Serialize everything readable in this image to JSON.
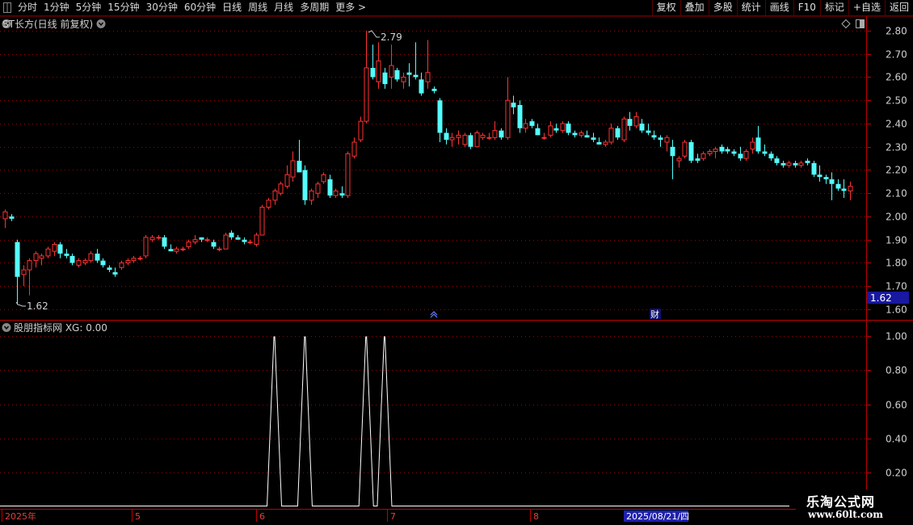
{
  "toolbar": {
    "periods": [
      "分时",
      "1分钟",
      "5分钟",
      "15分钟",
      "30分钟",
      "60分钟",
      "日线",
      "周线",
      "月线",
      "多周期",
      "更多 >"
    ],
    "active_period": "日线",
    "right_buttons": [
      "复权",
      "叠加",
      "多股",
      "统计",
      "画线",
      "F10",
      "标记",
      "+自选",
      "返回"
    ]
  },
  "main_chart": {
    "title": "ST长方(日线 前复权)",
    "high_label": "2.79",
    "low_label": "1.62",
    "current_price_tag": "1.62",
    "event_marker": "财",
    "price_axis": [
      "2.80",
      "2.70",
      "2.60",
      "2.50",
      "2.40",
      "2.30",
      "2.20",
      "2.10",
      "2.00",
      "1.90",
      "1.80",
      "1.70",
      "1.60"
    ]
  },
  "indicator": {
    "title": "股朋指标网 XG: 0.00",
    "axis": [
      "1.00",
      "0.80",
      "0.60",
      "0.40",
      "0.20"
    ]
  },
  "date_axis": {
    "labels": [
      "2025年",
      "5",
      "6",
      "7",
      "8"
    ],
    "cursor_date": "2025/08/21/四"
  },
  "watermark": {
    "line1": "乐淘公式网",
    "line2": "www.60lt.com"
  },
  "colors": {
    "up": "#ff3232",
    "down": "#54fcfc",
    "grid": "#a00000",
    "signal": "#ffffff"
  },
  "chart_data": {
    "type": "candlestick",
    "ylim": [
      1.6,
      2.82
    ],
    "ohlc": [
      [
        1.99,
        2.03,
        1.95,
        2.02
      ],
      [
        2.0,
        2.01,
        1.98,
        1.99
      ],
      [
        1.89,
        1.9,
        1.62,
        1.74
      ],
      [
        1.75,
        1.79,
        1.7,
        1.77
      ],
      [
        1.77,
        1.82,
        1.66,
        1.81
      ],
      [
        1.81,
        1.85,
        1.78,
        1.84
      ],
      [
        1.82,
        1.84,
        1.79,
        1.83
      ],
      [
        1.83,
        1.87,
        1.82,
        1.86
      ],
      [
        1.85,
        1.89,
        1.83,
        1.88
      ],
      [
        1.88,
        1.89,
        1.82,
        1.84
      ],
      [
        1.84,
        1.86,
        1.82,
        1.83
      ],
      [
        1.83,
        1.84,
        1.79,
        1.8
      ],
      [
        1.79,
        1.82,
        1.78,
        1.81
      ],
      [
        1.8,
        1.82,
        1.79,
        1.81
      ],
      [
        1.81,
        1.85,
        1.8,
        1.84
      ],
      [
        1.84,
        1.86,
        1.8,
        1.81
      ],
      [
        1.81,
        1.82,
        1.78,
        1.79
      ],
      [
        1.78,
        1.79,
        1.76,
        1.77
      ],
      [
        1.76,
        1.78,
        1.74,
        1.75
      ],
      [
        1.78,
        1.81,
        1.77,
        1.8
      ],
      [
        1.8,
        1.82,
        1.79,
        1.81
      ],
      [
        1.81,
        1.83,
        1.8,
        1.82
      ],
      [
        1.82,
        1.83,
        1.81,
        1.82
      ],
      [
        1.83,
        1.92,
        1.82,
        1.91
      ],
      [
        1.9,
        1.92,
        1.89,
        1.91
      ],
      [
        1.91,
        1.92,
        1.9,
        1.91
      ],
      [
        1.91,
        1.92,
        1.86,
        1.87
      ],
      [
        1.86,
        1.88,
        1.85,
        1.85
      ],
      [
        1.85,
        1.87,
        1.84,
        1.86
      ],
      [
        1.86,
        1.87,
        1.85,
        1.86
      ],
      [
        1.87,
        1.9,
        1.86,
        1.89
      ],
      [
        1.89,
        1.92,
        1.88,
        1.9
      ],
      [
        1.91,
        1.91,
        1.89,
        1.9
      ],
      [
        1.9,
        1.91,
        1.89,
        1.9
      ],
      [
        1.89,
        1.9,
        1.86,
        1.87
      ],
      [
        1.86,
        1.87,
        1.85,
        1.86
      ],
      [
        1.86,
        1.93,
        1.86,
        1.92
      ],
      [
        1.93,
        1.94,
        1.9,
        1.91
      ],
      [
        1.91,
        1.92,
        1.9,
        1.9
      ],
      [
        1.9,
        1.91,
        1.88,
        1.89
      ],
      [
        1.89,
        1.9,
        1.88,
        1.89
      ],
      [
        1.88,
        1.93,
        1.87,
        1.92
      ],
      [
        1.92,
        2.05,
        1.92,
        2.04
      ],
      [
        2.04,
        2.08,
        2.03,
        2.07
      ],
      [
        2.07,
        2.12,
        2.05,
        2.11
      ],
      [
        2.1,
        2.15,
        2.09,
        2.14
      ],
      [
        2.13,
        2.22,
        2.12,
        2.18
      ],
      [
        2.17,
        2.28,
        2.15,
        2.24
      ],
      [
        2.24,
        2.33,
        2.2,
        2.19
      ],
      [
        2.2,
        2.22,
        2.05,
        2.07
      ],
      [
        2.07,
        2.12,
        2.05,
        2.11
      ],
      [
        2.1,
        2.15,
        2.08,
        2.14
      ],
      [
        2.15,
        2.19,
        2.14,
        2.18
      ],
      [
        2.16,
        2.18,
        2.08,
        2.09
      ],
      [
        2.09,
        2.12,
        2.08,
        2.11
      ],
      [
        2.1,
        2.13,
        2.08,
        2.09
      ],
      [
        2.09,
        2.28,
        2.08,
        2.27
      ],
      [
        2.26,
        2.34,
        2.25,
        2.32
      ],
      [
        2.33,
        2.43,
        2.32,
        2.41
      ],
      [
        2.41,
        2.8,
        2.4,
        2.64
      ],
      [
        2.64,
        2.74,
        2.59,
        2.6
      ],
      [
        2.58,
        2.75,
        2.55,
        2.67
      ],
      [
        2.62,
        2.64,
        2.55,
        2.57
      ],
      [
        2.6,
        2.74,
        2.55,
        2.65
      ],
      [
        2.63,
        2.64,
        2.58,
        2.59
      ],
      [
        2.58,
        2.62,
        2.55,
        2.6
      ],
      [
        2.62,
        2.66,
        2.56,
        2.61
      ],
      [
        2.61,
        2.75,
        2.59,
        2.6
      ],
      [
        2.59,
        2.62,
        2.52,
        2.53
      ],
      [
        2.58,
        2.76,
        2.55,
        2.62
      ],
      [
        2.55,
        2.56,
        2.53,
        2.54
      ],
      [
        2.5,
        2.51,
        2.32,
        2.36
      ],
      [
        2.36,
        2.38,
        2.31,
        2.33
      ],
      [
        2.33,
        2.36,
        2.3,
        2.34
      ],
      [
        2.34,
        2.37,
        2.31,
        2.35
      ],
      [
        2.31,
        2.36,
        2.3,
        2.35
      ],
      [
        2.35,
        2.36,
        2.29,
        2.3
      ],
      [
        2.3,
        2.37,
        2.3,
        2.36
      ],
      [
        2.34,
        2.36,
        2.33,
        2.35
      ],
      [
        2.34,
        2.36,
        2.33,
        2.34
      ],
      [
        2.34,
        2.41,
        2.33,
        2.37
      ],
      [
        2.37,
        2.38,
        2.33,
        2.34
      ],
      [
        2.34,
        2.6,
        2.33,
        2.5
      ],
      [
        2.49,
        2.52,
        2.44,
        2.47
      ],
      [
        2.48,
        2.5,
        2.36,
        2.38
      ],
      [
        2.38,
        2.42,
        2.36,
        2.4
      ],
      [
        2.41,
        2.42,
        2.38,
        2.39
      ],
      [
        2.38,
        2.4,
        2.35,
        2.35
      ],
      [
        2.34,
        2.36,
        2.33,
        2.34
      ],
      [
        2.35,
        2.41,
        2.34,
        2.39
      ],
      [
        2.38,
        2.4,
        2.36,
        2.37
      ],
      [
        2.37,
        2.41,
        2.36,
        2.4
      ],
      [
        2.4,
        2.41,
        2.35,
        2.36
      ],
      [
        2.36,
        2.37,
        2.34,
        2.35
      ],
      [
        2.35,
        2.37,
        2.34,
        2.36
      ],
      [
        2.35,
        2.37,
        2.34,
        2.34
      ],
      [
        2.34,
        2.36,
        2.32,
        2.33
      ],
      [
        2.32,
        2.34,
        2.31,
        2.31
      ],
      [
        2.31,
        2.33,
        2.3,
        2.32
      ],
      [
        2.32,
        2.4,
        2.31,
        2.38
      ],
      [
        2.38,
        2.39,
        2.33,
        2.34
      ],
      [
        2.33,
        2.43,
        2.32,
        2.42
      ],
      [
        2.42,
        2.45,
        2.37,
        2.39
      ],
      [
        2.39,
        2.45,
        2.38,
        2.43
      ],
      [
        2.4,
        2.42,
        2.36,
        2.37
      ],
      [
        2.37,
        2.4,
        2.35,
        2.36
      ],
      [
        2.35,
        2.37,
        2.33,
        2.34
      ],
      [
        2.34,
        2.35,
        2.3,
        2.33
      ],
      [
        2.32,
        2.35,
        2.28,
        2.34
      ],
      [
        2.3,
        2.33,
        2.16,
        2.26
      ],
      [
        2.24,
        2.26,
        2.21,
        2.25
      ],
      [
        2.26,
        2.33,
        2.25,
        2.32
      ],
      [
        2.32,
        2.33,
        2.23,
        2.24
      ],
      [
        2.25,
        2.27,
        2.23,
        2.24
      ],
      [
        2.25,
        2.28,
        2.24,
        2.27
      ],
      [
        2.27,
        2.29,
        2.26,
        2.28
      ],
      [
        2.28,
        2.3,
        2.25,
        2.29
      ],
      [
        2.3,
        2.31,
        2.27,
        2.28
      ],
      [
        2.29,
        2.3,
        2.27,
        2.28
      ],
      [
        2.28,
        2.29,
        2.26,
        2.27
      ],
      [
        2.27,
        2.3,
        2.24,
        2.25
      ],
      [
        2.25,
        2.29,
        2.24,
        2.28
      ],
      [
        2.29,
        2.34,
        2.27,
        2.32
      ],
      [
        2.34,
        2.39,
        2.27,
        2.28
      ],
      [
        2.28,
        2.31,
        2.26,
        2.27
      ],
      [
        2.27,
        2.28,
        2.24,
        2.25
      ],
      [
        2.25,
        2.26,
        2.22,
        2.23
      ],
      [
        2.23,
        2.24,
        2.21,
        2.22
      ],
      [
        2.22,
        2.24,
        2.21,
        2.23
      ],
      [
        2.23,
        2.24,
        2.21,
        2.22
      ],
      [
        2.22,
        2.24,
        2.21,
        2.23
      ],
      [
        2.24,
        2.25,
        2.22,
        2.23
      ],
      [
        2.23,
        2.24,
        2.17,
        2.18
      ],
      [
        2.18,
        2.22,
        2.15,
        2.17
      ],
      [
        2.17,
        2.18,
        2.14,
        2.16
      ],
      [
        2.16,
        2.19,
        2.07,
        2.14
      ],
      [
        2.14,
        2.16,
        2.11,
        2.12
      ],
      [
        2.12,
        2.16,
        2.08,
        2.11
      ],
      [
        2.11,
        2.15,
        2.07,
        2.13
      ]
    ],
    "signal_days": [
      44,
      49,
      59,
      62
    ]
  }
}
